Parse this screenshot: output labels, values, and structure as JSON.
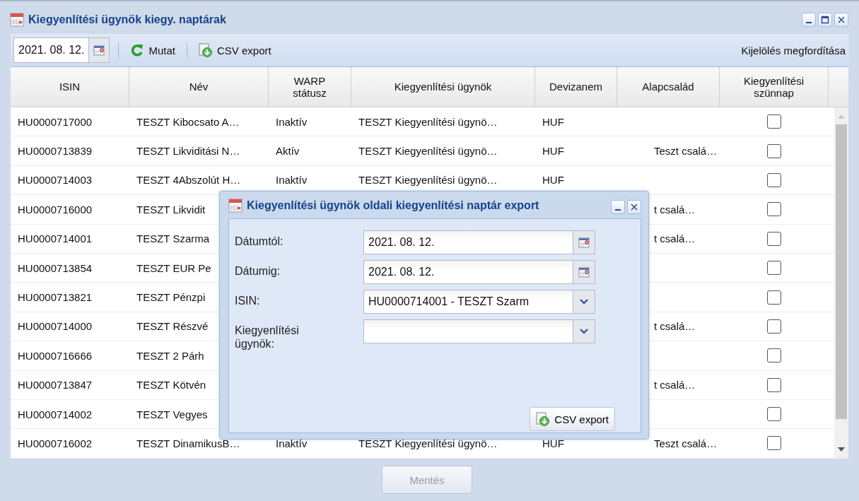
{
  "window": {
    "title": "Kiegyenlítési ügynök kiegy. naptárak"
  },
  "toolbar": {
    "date": "2021. 08. 12.",
    "show_button": "Mutat",
    "export_button": "CSV export",
    "invert_selection": "Kijelölés megfordítása"
  },
  "table": {
    "columns": [
      "ISIN",
      "Név",
      "WARP\nstátusz",
      "Kiegyenlítési ügynök",
      "Devizanem",
      "Alapcsalád",
      "Kiegyenlítési\nszünnap"
    ],
    "rows": [
      {
        "isin": "HU0000717000",
        "name": "TESZT Kibocsato A…",
        "status": "Inaktív",
        "agent": "TESZT Kiegyenlítési ügynö…",
        "currency": "HUF",
        "holiday": false
      },
      {
        "isin": "HU0000713839",
        "name": "TESZT Likviditási N…",
        "status": "Aktív",
        "agent": "TESZT Kiegyenlítési ügynö…",
        "currency": "HUF",
        "family": "Teszt csalá…",
        "holiday": false
      },
      {
        "isin": "HU0000714003",
        "name": "TESZT 4Abszolút H…",
        "status": "Inaktív",
        "agent": "TESZT Kiegyenlítési ügynö…",
        "currency": "HUF",
        "holiday": false
      },
      {
        "isin": "HU0000716000",
        "name": "TESZT Likvidit",
        "family": "t csalá…",
        "holiday": false
      },
      {
        "isin": "HU0000714001",
        "name": "TESZT Szarma",
        "family": "t csalá…",
        "holiday": false
      },
      {
        "isin": "HU0000713854",
        "name": "TESZT EUR Pe",
        "holiday": false
      },
      {
        "isin": "HU0000713821",
        "name": "TESZT Pénzpi",
        "holiday": false
      },
      {
        "isin": "HU0000714000",
        "name": "TESZT Részvé",
        "family": "t csalá…",
        "holiday": false
      },
      {
        "isin": "HU0000716666",
        "name": "TESZT 2 Párh",
        "holiday": false
      },
      {
        "isin": "HU0000713847",
        "name": "TESZT Kötvén",
        "family": "t csalá…",
        "holiday": false
      },
      {
        "isin": "HU0000714002",
        "name": "TESZT Vegyes",
        "holiday": false
      },
      {
        "isin": "HU0000716002",
        "name": "TESZT DinamikusB…",
        "status": "Inaktív",
        "agent": "TESZT Kiegyenlítési ügynö…",
        "currency": "HUF",
        "family": "Teszt csalá…",
        "holiday": false
      }
    ]
  },
  "save_button": {
    "label": "Mentés",
    "disabled": true
  },
  "dialog": {
    "title": "Kiegyenlítési ügynök oldali kiegyenlítési naptár export",
    "fields": [
      {
        "kind": "date",
        "label": "Dátumtól:",
        "value": "2021. 08. 12."
      },
      {
        "kind": "date",
        "label": "Dátumig:",
        "value": "2021. 08. 12."
      },
      {
        "kind": "combo",
        "label": "ISIN:",
        "value": "HU0000714001 - TESZT Szarm"
      },
      {
        "kind": "combo",
        "label": "Kiegyenlítési ügynök:"
      }
    ],
    "export_button": "CSV export"
  }
}
